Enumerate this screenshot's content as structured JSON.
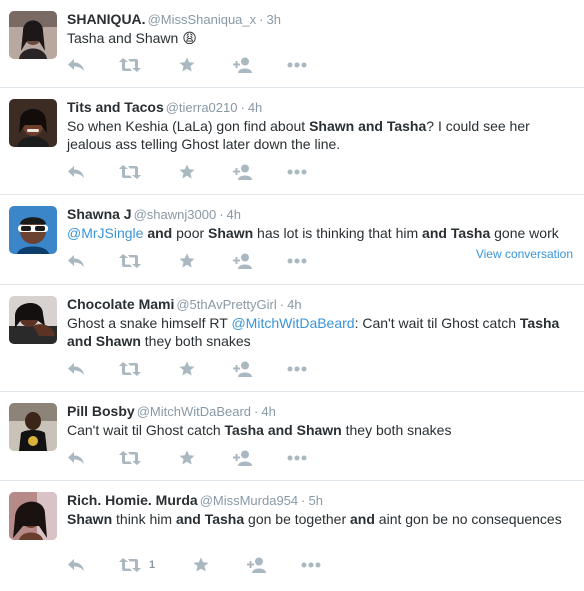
{
  "tweets": [
    {
      "name": "SHANIQUA.",
      "handle": "@MissShaniqua_x",
      "time": "3h",
      "segments": [
        {
          "t": "Tasha and Shawn "
        },
        {
          "t": "😩",
          "emoji": true
        }
      ],
      "retweet_count": ""
    },
    {
      "name": "Tits and Tacos",
      "handle": "@tierra0210",
      "time": "4h",
      "segments": [
        {
          "t": "So when Keshia (LaLa) gon find about "
        },
        {
          "t": "Shawn and Tasha",
          "b": true
        },
        {
          "t": "? I could see her jealous ass telling Ghost later down the line."
        }
      ],
      "retweet_count": ""
    },
    {
      "name": "Shawna J",
      "handle": "@shawnj3000",
      "time": "4h",
      "segments": [
        {
          "t": "@MrJSingle",
          "mention": true
        },
        {
          "t": " "
        },
        {
          "t": "and",
          "b": true
        },
        {
          "t": " poor "
        },
        {
          "t": "Shawn",
          "b": true
        },
        {
          "t": " has lot is thinking that him "
        },
        {
          "t": "and Tasha",
          "b": true
        },
        {
          "t": " gone work"
        }
      ],
      "view_conversation": "View conversation",
      "retweet_count": ""
    },
    {
      "name": "Chocolate Mami",
      "handle": "@5thAvPrettyGirl",
      "time": "4h",
      "segments": [
        {
          "t": "Ghost a snake himself RT "
        },
        {
          "t": "@MitchWitDaBeard",
          "mention": true
        },
        {
          "t": ": Can't wait til Ghost catch "
        },
        {
          "t": "Tasha and Shawn",
          "b": true
        },
        {
          "t": " they both snakes"
        }
      ],
      "retweet_count": ""
    },
    {
      "name": "Pill Bosby",
      "handle": "@MitchWitDaBeard",
      "time": "4h",
      "segments": [
        {
          "t": "Can't wait til Ghost catch "
        },
        {
          "t": "Tasha and Shawn",
          "b": true
        },
        {
          "t": " they both snakes"
        }
      ],
      "retweet_count": ""
    },
    {
      "name": "Rich. Homie. Murda",
      "handle": "@MissMurda954",
      "time": "5h",
      "segments": [
        {
          "t": "Shawn",
          "b": true
        },
        {
          "t": " think him "
        },
        {
          "t": "and Tasha",
          "b": true
        },
        {
          "t": " gon be together "
        },
        {
          "t": "and",
          "b": true
        },
        {
          "t": " aint gon be no consequences"
        }
      ],
      "retweet_count": "1"
    }
  ],
  "colors": {
    "accent": "#3b94d9",
    "muted": "#8899a6",
    "icon": "#aab8c2",
    "text": "#292f33",
    "divider": "#e1e8ed"
  },
  "icons": [
    "reply-icon",
    "retweet-icon",
    "favorite-icon",
    "follow-icon",
    "more-icon"
  ]
}
